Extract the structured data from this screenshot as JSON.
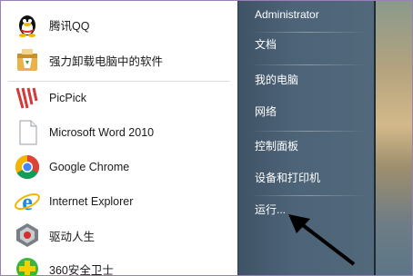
{
  "programs": [
    {
      "label": "腾讯QQ",
      "icon": "qq-penguin-icon"
    },
    {
      "label": "强力卸载电脑中的软件",
      "icon": "uninstall-box-icon"
    },
    {
      "label": "PicPick",
      "icon": "picpick-icon"
    },
    {
      "label": "Microsoft Word 2010",
      "icon": "document-icon"
    },
    {
      "label": "Google Chrome",
      "icon": "chrome-icon"
    },
    {
      "label": "Internet Explorer",
      "icon": "ie-icon"
    },
    {
      "label": "驱动人生",
      "icon": "driver-life-icon"
    },
    {
      "label": "360安全卫士",
      "icon": "360-shield-icon"
    }
  ],
  "right_menu": {
    "user": "Administrator",
    "documents": "文档",
    "computer": "我的电脑",
    "network": "网络",
    "control_panel": "控制面板",
    "devices_printers": "设备和打印机",
    "run": "运行..."
  },
  "colors": {
    "right_pane": "#4d6377",
    "accent_border": "#9b7fb7"
  }
}
